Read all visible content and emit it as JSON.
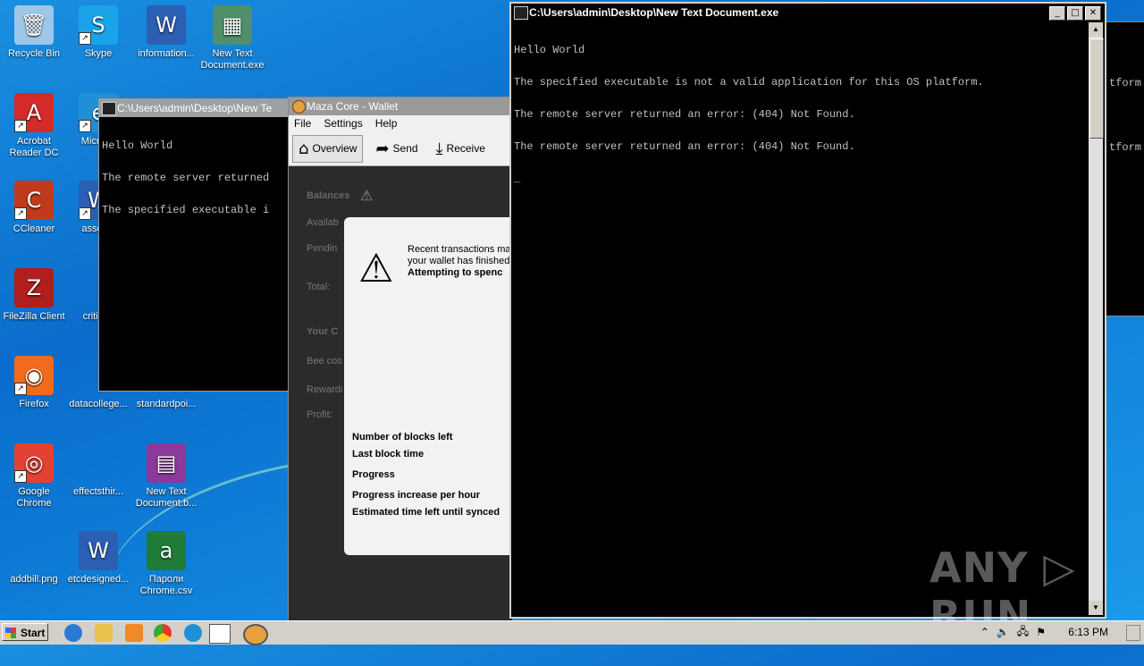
{
  "desktop": {
    "icons": [
      {
        "label": "Recycle Bin",
        "glyph": "🗑",
        "shortcut": false
      },
      {
        "label": "Skype",
        "glyph": "S",
        "shortcut": true
      },
      {
        "label": "information...",
        "glyph": "W",
        "shortcut": false
      },
      {
        "label": "New Text\nDocument.exe",
        "glyph": "▦",
        "shortcut": false
      },
      {
        "label": "Acrobat\nReader DC",
        "glyph": "A",
        "shortcut": true
      },
      {
        "label": "Microso",
        "glyph": "e",
        "shortcut": true
      },
      {
        "label": "CCleaner",
        "glyph": "C",
        "shortcut": true
      },
      {
        "label": "associa",
        "glyph": "W",
        "shortcut": true
      },
      {
        "label": "FileZilla Client",
        "glyph": "Z",
        "shortcut": false
      },
      {
        "label": "criticalr",
        "glyph": "",
        "shortcut": false
      },
      {
        "label": "Firefox",
        "glyph": "◉",
        "shortcut": true
      },
      {
        "label": "datacollege...",
        "glyph": "",
        "shortcut": false
      },
      {
        "label": "standardpoi...",
        "glyph": "",
        "shortcut": false
      },
      {
        "label": "Google\nChrome",
        "glyph": "◎",
        "shortcut": true
      },
      {
        "label": "effectsthir...",
        "glyph": "",
        "shortcut": false
      },
      {
        "label": "New Text\nDocument.b...",
        "glyph": "▤",
        "shortcut": false
      },
      {
        "label": "addbill.png",
        "glyph": "",
        "shortcut": false
      },
      {
        "label": "etcdesigned...",
        "glyph": "W",
        "shortcut": false
      },
      {
        "label": "Пароли\nChrome.csv",
        "glyph": "a",
        "shortcut": false
      }
    ]
  },
  "console_back": {
    "title": "C:\\Users\\admin\\Desktop\\New Te",
    "lines": [
      "Hello World",
      "The remote server returned",
      "The specified executable i"
    ]
  },
  "console_main": {
    "title": "C:\\Users\\admin\\Desktop\\New Text Document.exe",
    "lines": [
      "Hello World",
      "The specified executable is not a valid application for this OS platform.",
      "The remote server returned an error: (404) Not Found.",
      "The remote server returned an error: (404) Not Found.",
      "_"
    ],
    "controls": {
      "minimize": "_",
      "maximize": "□",
      "close": "✕"
    }
  },
  "right_panel": {
    "lines": [
      "tform.",
      "tform."
    ]
  },
  "wallet": {
    "title": "Maza Core - Wallet",
    "menu": [
      "File",
      "Settings",
      "Help"
    ],
    "toolbar": [
      {
        "label": "Overview",
        "icon": "home-icon",
        "glyph": "⌂"
      },
      {
        "label": "Send",
        "icon": "send-arrow-icon",
        "glyph": "➦"
      },
      {
        "label": "Receive",
        "icon": "receive-inbox-icon",
        "glyph": "⤓"
      }
    ],
    "background_labels": {
      "balances": "Balances",
      "available": "Availab",
      "pending": "Pendin",
      "total": "Total:",
      "your_coins": "Your C",
      "bee_cost": "Bee cos",
      "rewards": "Rewardi",
      "profit": "Profit:"
    },
    "modal": {
      "message": [
        "Recent transactions ma",
        "your wallet has finished",
        "Attempting to spenc"
      ],
      "labels": [
        "Number of blocks left",
        "Last block time",
        "Progress",
        "Progress increase per hour",
        "Estimated time left until synced"
      ]
    }
  },
  "taskbar": {
    "start_label": "Start",
    "clock": "6:13 PM",
    "tray_icons": [
      "chevron-up-icon",
      "speaker-icon",
      "network-icon",
      "flag-icon"
    ],
    "tray_glyphs": [
      "⌃",
      "🔈",
      "🖧",
      "⚑"
    ]
  },
  "watermark": "ANY ▷ RUN"
}
